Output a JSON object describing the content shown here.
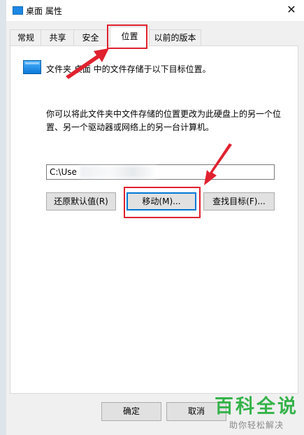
{
  "window": {
    "title": "桌面 属性",
    "close_symbol": "✕"
  },
  "tabs": [
    {
      "label": "常规"
    },
    {
      "label": "共享"
    },
    {
      "label": "安全"
    },
    {
      "label": "位置",
      "active": true
    },
    {
      "label": "以前的版本"
    }
  ],
  "location": {
    "folder_line": "文件夹 桌面 中的文件存储于以下目标位置。",
    "description": "你可以将此文件夹中文件存储的位置更改为此硬盘上的另一个位置、另一个驱动器或网络上的另一台计算机。",
    "path_value": "C:\\Use",
    "restore_button": "还原默认值(R)",
    "move_button": "移动(M)...",
    "find_target_button": "查找目标(F)..."
  },
  "footer": {
    "ok_button": "确定",
    "cancel_button": "取消"
  },
  "watermark": {
    "main": "百科全说",
    "sub": "助你轻松解决"
  },
  "colors": {
    "annotation_red": "#e0212f",
    "accent_blue": "#0078d7",
    "brand_green": "#35b34a"
  }
}
